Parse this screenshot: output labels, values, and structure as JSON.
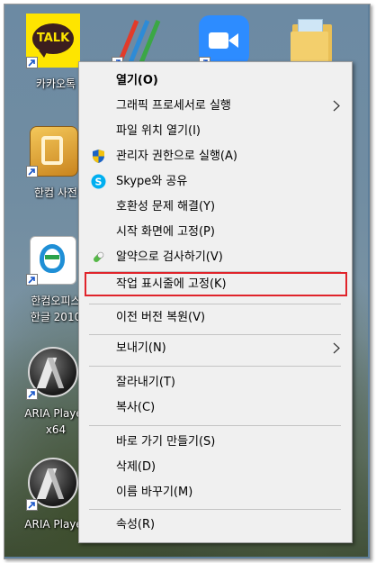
{
  "desktop": {
    "icons": [
      {
        "label": "카카오톡",
        "badge": "TALK"
      },
      {
        "label": ""
      },
      {
        "label": ""
      },
      {
        "label": ""
      },
      {
        "label": "한컴 사전"
      },
      {
        "label": "한컴오피스",
        "label2": "한글 2010"
      },
      {
        "label": "ARIA Player",
        "label2": "x64"
      },
      {
        "label": "ARIA Player"
      }
    ]
  },
  "menu": {
    "items": [
      {
        "label": "열기(O)"
      },
      {
        "label": "그래픽 프로세서로 실행"
      },
      {
        "label": "파일 위치 열기(I)"
      },
      {
        "label": "관리자 권한으로 실행(A)",
        "icon": "shield-icon"
      },
      {
        "label": "Skype와 공유",
        "icon": "skype-icon"
      },
      {
        "label": "호환성 문제 해결(Y)"
      },
      {
        "label": "시작 화면에 고정(P)"
      },
      {
        "label": "알약으로 검사하기(V)",
        "icon": "alyac-pill-icon"
      },
      {
        "label": "작업 표시줄에 고정(K)"
      },
      {
        "label": "이전 버전 복원(V)"
      },
      {
        "label": "보내기(N)"
      },
      {
        "label": "잘라내기(T)"
      },
      {
        "label": "복사(C)"
      },
      {
        "label": "바로 가기 만들기(S)"
      },
      {
        "label": "삭제(D)"
      },
      {
        "label": "이름 바꾸기(M)"
      },
      {
        "label": "속성(R)"
      }
    ]
  },
  "colors": {
    "menu_bg": "#f0f0f0",
    "highlight": "#e0242b",
    "kakao_yellow": "#fee500",
    "zoom_blue": "#2d8cff"
  }
}
